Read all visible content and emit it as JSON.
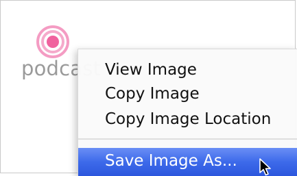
{
  "page": {
    "logo_text": "podcast",
    "logo_icon": "podcast-broadcast-icon",
    "logo_color": "#f472a8"
  },
  "context_menu": {
    "items": [
      {
        "label": "View Image",
        "highlighted": false
      },
      {
        "label": "Copy Image",
        "highlighted": false
      },
      {
        "label": "Copy Image Location",
        "highlighted": false
      },
      {
        "label": "Save Image As...",
        "highlighted": true
      }
    ],
    "highlight_color": "#3d6aea"
  },
  "cursor": {
    "icon": "arrow-cursor-icon"
  }
}
